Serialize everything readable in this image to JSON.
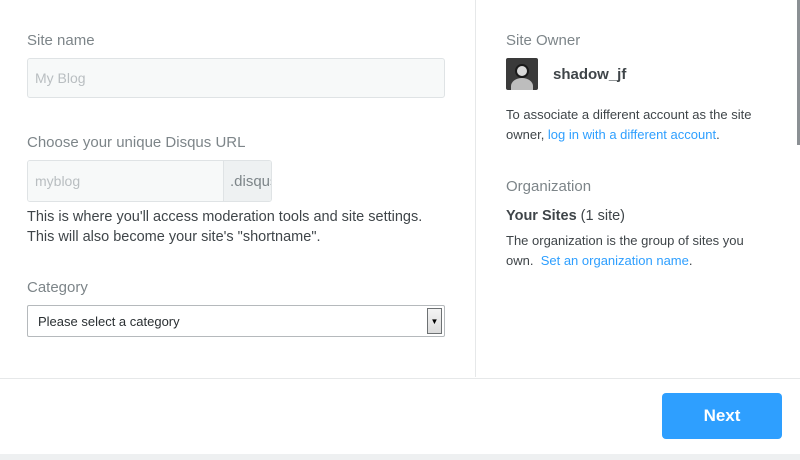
{
  "form": {
    "site_name_label": "Site name",
    "site_name_placeholder": "My Blog",
    "url_label": "Choose your unique Disqus URL",
    "url_placeholder": "myblog",
    "url_suffix": ".disqus.com",
    "url_help_line1": "This is where you'll access moderation tools and site settings.",
    "url_help_line2": "This will also become your site's \"shortname\".",
    "category_label": "Category",
    "category_selected": "Please select a category"
  },
  "sidebar": {
    "owner_label": "Site Owner",
    "owner_name": "shadow_jf",
    "associate_text": "To associate a different account as the site owner, ",
    "associate_link": "log in with a different account",
    "associate_end": ".",
    "organization_label": "Organization",
    "your_sites": "Your Sites",
    "site_count": "(1 site)",
    "org_text": "The organization is the group of sites you own.",
    "org_link": "Set an organization name",
    "org_end": "."
  },
  "footer": {
    "next_label": "Next"
  },
  "colors": {
    "accent": "#2e9fff",
    "text": "#3f4549",
    "muted": "#7d8589"
  },
  "icons": {
    "avatar": "user-avatar-icon",
    "select_arrow": "chevron-down-icon"
  }
}
